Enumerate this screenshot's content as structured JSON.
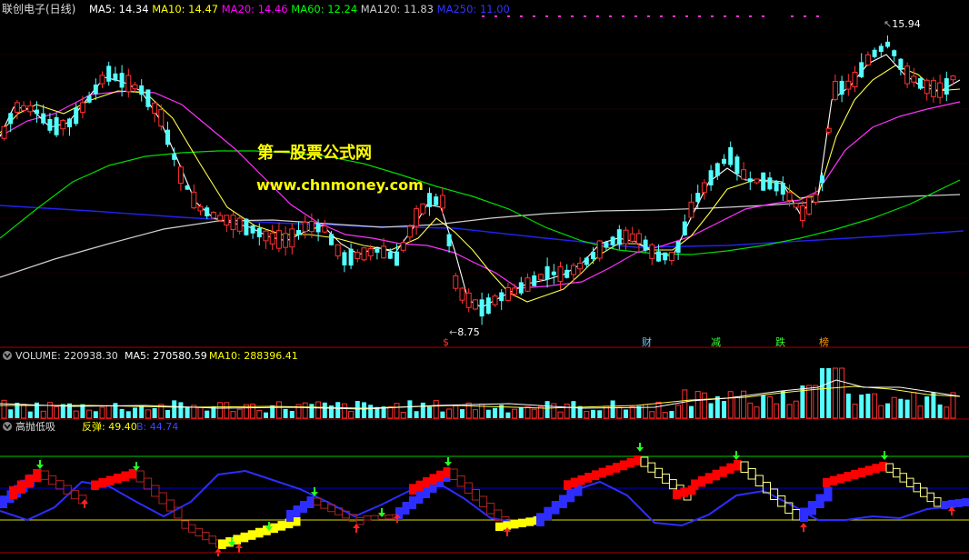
{
  "price_panel": {
    "title": "联创电子(日线)",
    "ma_labels": [
      {
        "name": "MA5",
        "value": "14.34",
        "color": "#ffffff"
      },
      {
        "name": "MA10",
        "value": "14.47",
        "color": "#ffff00"
      },
      {
        "name": "MA20",
        "value": "14.46",
        "color": "#ff00ff"
      },
      {
        "name": "MA60",
        "value": "12.24",
        "color": "#00ff00"
      },
      {
        "name": "MA120",
        "value": "11.83",
        "color": "#cccccc"
      },
      {
        "name": "MA250",
        "value": "11.00",
        "color": "#3333ff"
      }
    ],
    "high_marker": "15.94",
    "low_marker": "8.75",
    "watermark_1": "第一股票公式网",
    "watermark_2": "www.chnmoney.com",
    "event_markers": [
      {
        "label": "$",
        "color": "#ff3333"
      },
      {
        "label": "财",
        "color": "#66ccff"
      },
      {
        "label": "减",
        "color": "#33ff33"
      },
      {
        "label": "跌",
        "color": "#33ff33"
      },
      {
        "label": "榜",
        "color": "#ff9900"
      }
    ]
  },
  "volume_panel": {
    "label": "VOLUME: 220938.30",
    "ma5": "MA5: 270580.59",
    "ma10": "MA10: 288396.41"
  },
  "indicator_panel": {
    "name": "高抛低吸",
    "rebound": "反弹: 49.40",
    "extra": "B: 44.74"
  },
  "colors": {
    "up": "#ff3232",
    "down": "#54ffff",
    "axis_line": "#aa0000",
    "ma250": "#2222ee",
    "indicator_blue": "#2d2dff",
    "indicator_red": "#ff0000",
    "indicator_yellow": "#ffff00"
  },
  "icons": {
    "collapse": "circle-chevron-down-icon",
    "up_arrow": "red-up-arrow-icon",
    "down_arrow": "green-down-arrow-icon"
  }
}
